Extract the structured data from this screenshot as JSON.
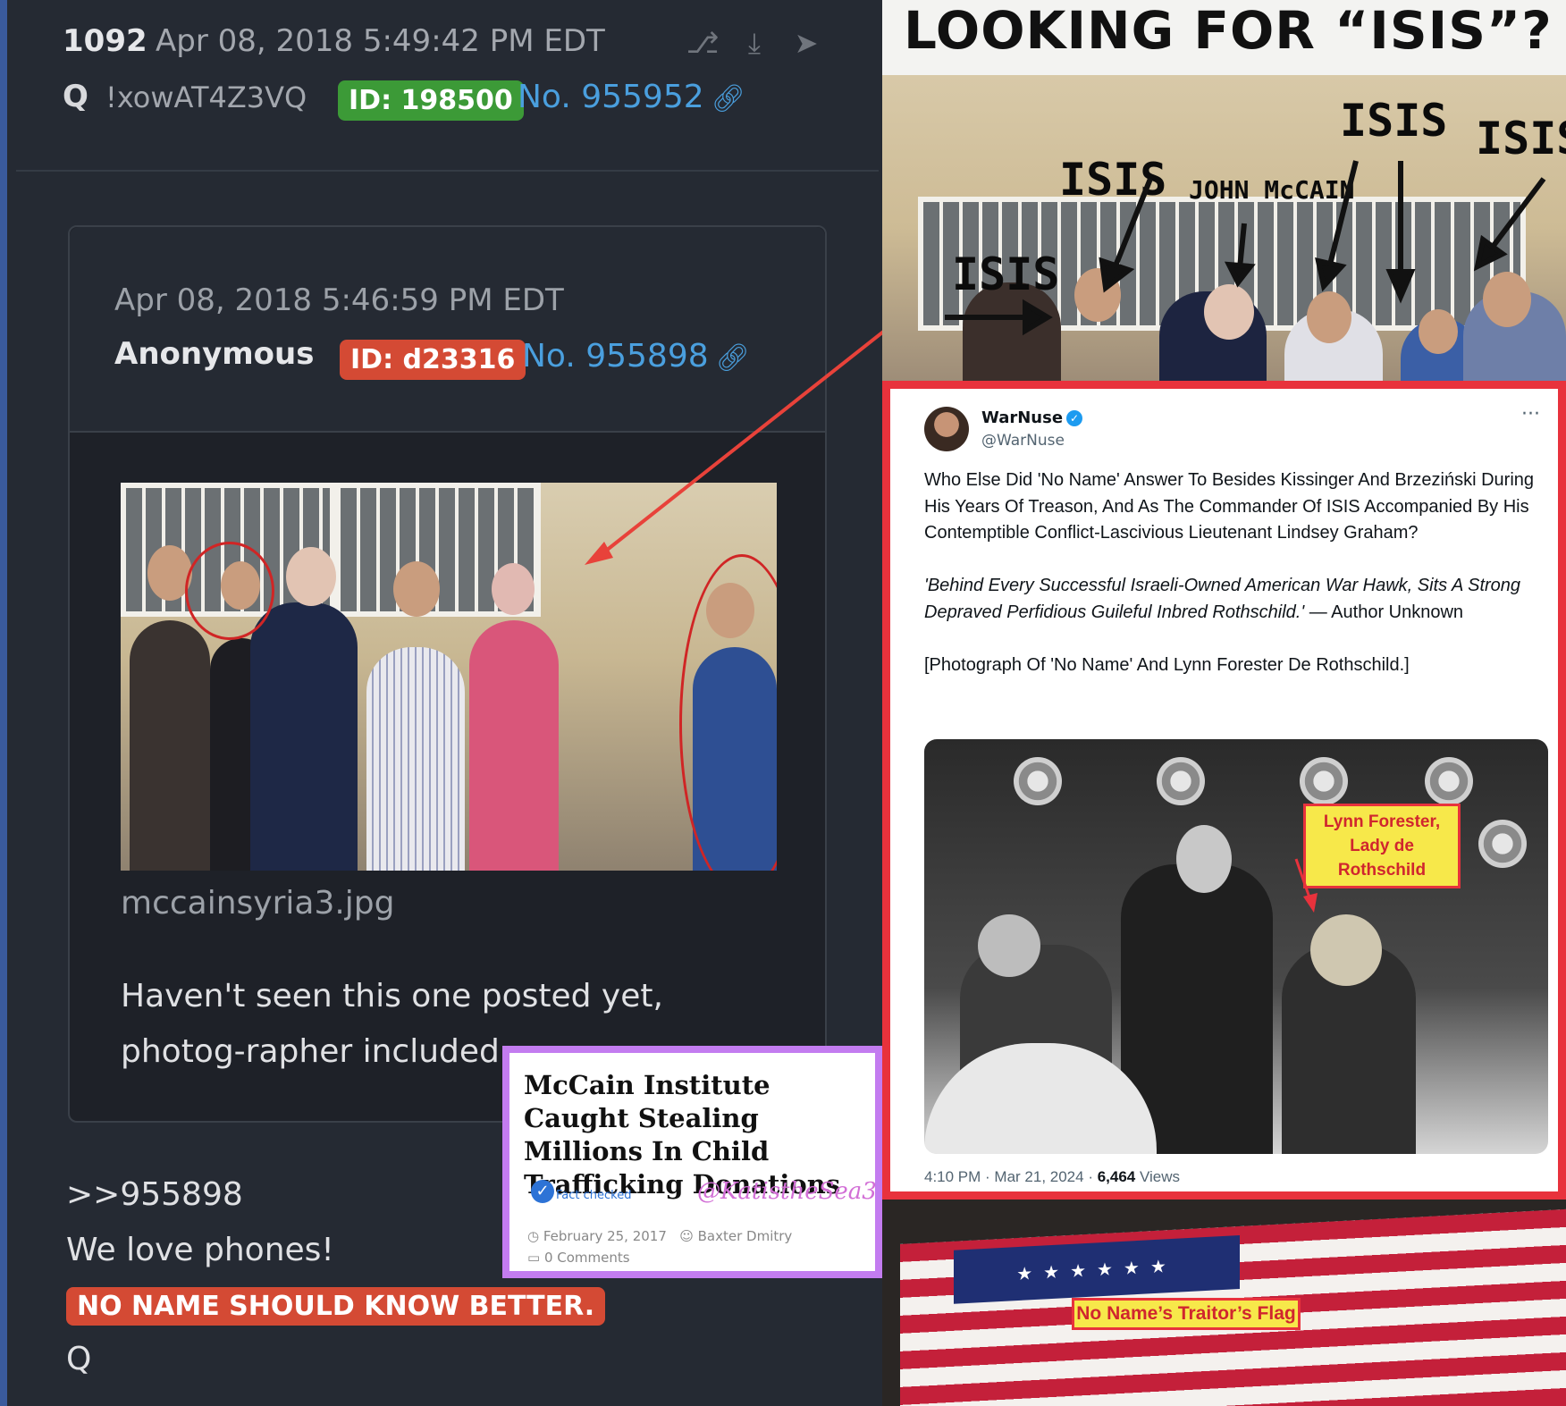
{
  "q_post": {
    "number": "1092",
    "date": "Apr 08, 2018 5:49:42 PM EDT",
    "author": "Q",
    "tripcode": "!xowAT4Z3VQ",
    "id_badge": "ID: 198500",
    "post_no": "No. 955952",
    "header_icons": [
      "share-icon",
      "download-icon",
      "forward-icon"
    ]
  },
  "quoted_post": {
    "date": "Apr 08, 2018 5:46:59 PM EDT",
    "author": "Anonymous",
    "id_badge": "ID: d23316",
    "post_no": "No. 955898",
    "image_filename": "mccainsyria3.jpg",
    "text": "Haven't seen this one posted yet, photog-rapher included"
  },
  "reply": {
    "reference": ">>955898",
    "line1": "We love phones!",
    "highlight": "NO NAME SHOULD KNOW BETTER.",
    "signature": "Q"
  },
  "clipping": {
    "title": "McCain Institute Caught Stealing Millions In Child Trafficking Donations",
    "fact_checked": "Fact checked",
    "watermark": "@KatistheSea3",
    "date": "February 25, 2017",
    "author": "Baxter Dmitry",
    "comments": "0 Comments"
  },
  "isis_image": {
    "banner": "LOOKING FOR “ISIS”?",
    "labels": [
      "ISIS",
      "ISIS",
      "JOHN McCAIN",
      "ISIS",
      "ISIS"
    ]
  },
  "tweet": {
    "display_name": "WarNuse",
    "handle": "@WarNuse",
    "more": "···",
    "paragraph1": "Who Else Did 'No Name' Answer To Besides Kissinger And Brzeziński During His Years Of Treason, And As The Commander Of ISIS Accompanied By His Contemptible Conflict-Lascivious Lieutenant Lindsey Graham?",
    "quote": "'Behind Every Successful Israeli-Owned American War Hawk, Sits A Strong Depraved Perfidious Guileful Inbred Rothschild.'",
    "quote_attribution": "— Author Unknown",
    "paragraph3": "[Photograph Of 'No Name' And Lynn Forester De Rothschild.]",
    "photo_label_line1": "Lynn Forester,",
    "photo_label_line2": "Lady de Rothschild",
    "time": "4:10 PM · Mar 21, 2024 · ",
    "views": "6,464",
    "views_label": " Views"
  },
  "flag_image": {
    "label": "No Name’s Traitor’s Flag"
  },
  "colors": {
    "q_id_badge": "#3c9a37",
    "anon_id_badge": "#d44a34",
    "link_blue": "#4a9fde",
    "tweet_border": "#e8323c",
    "clipping_border": "#c37cf0",
    "label_yellow": "#f7e84a"
  }
}
